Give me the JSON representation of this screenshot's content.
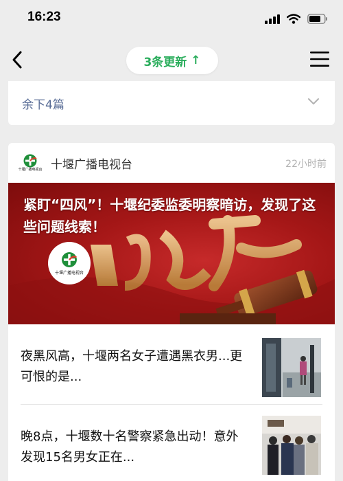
{
  "status": {
    "time": "16:23"
  },
  "nav": {
    "update_label": "3条更新",
    "update_arrow": "↑"
  },
  "remaining": {
    "label": "余下4篇"
  },
  "article": {
    "source_name": "十堰广播电视台",
    "source_time": "22小时前",
    "logo_text": "十堰广播电视台",
    "hero_title": "紧盯“四风”！十堰纪委监委明察暗访，发现了这些问题线索！",
    "items": [
      {
        "title": "夜黑风高，十堰两名女子遭遇黑衣男...更可恨的是..."
      },
      {
        "title": "晚8点，十堰数十名警察紧急出动！意外发现15名男女正在..."
      }
    ]
  },
  "colors": {
    "accent_green": "#2aad5c",
    "link_blue": "#576b95",
    "hero_red": "#a51717"
  },
  "icons": [
    "back-arrow-icon",
    "menu-icon",
    "chevron-down-icon",
    "signal-icon",
    "wifi-icon",
    "battery-icon"
  ]
}
